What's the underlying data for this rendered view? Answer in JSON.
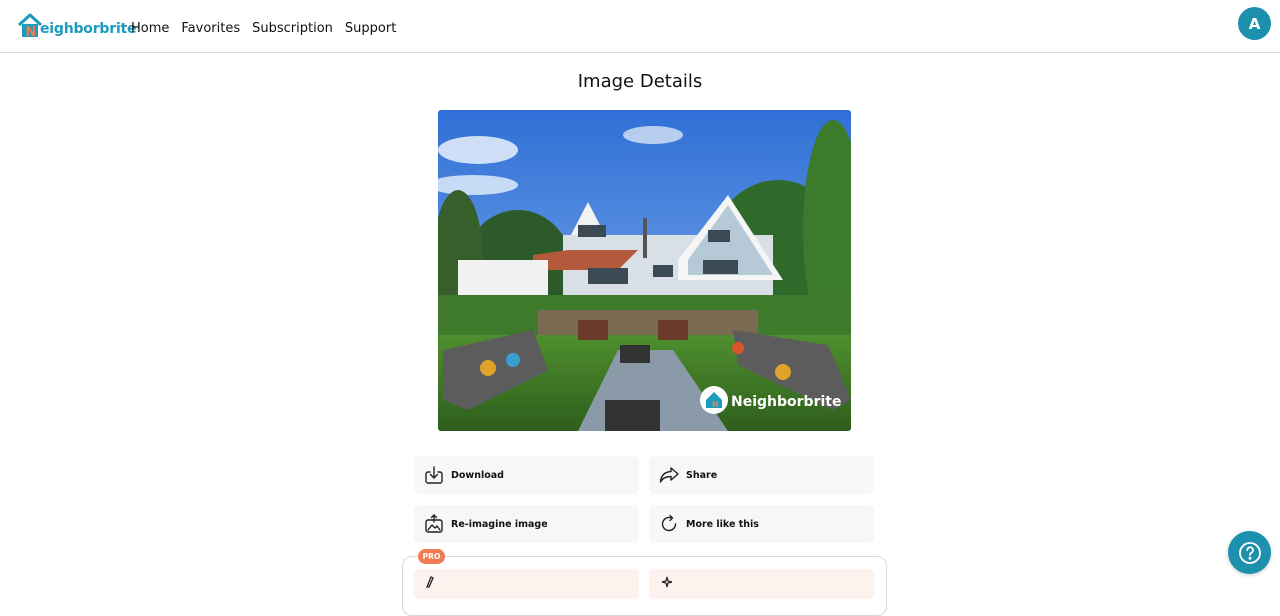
{
  "header": {
    "logo_text": "eighborbrite",
    "logo_letter": "N",
    "nav": [
      "Home",
      "Favorites",
      "Subscription",
      "Support"
    ],
    "avatar_initial": "A"
  },
  "page": {
    "title": "Image Details"
  },
  "image": {
    "watermark": "Neighborbrite"
  },
  "actions": {
    "download": "Download",
    "share": "Share",
    "reimagine": "Re-imagine image",
    "more_like_this": "More like this"
  },
  "pro": {
    "badge": "PRO"
  },
  "colors": {
    "brand": "#1c90ad",
    "accent": "#f07b53"
  }
}
